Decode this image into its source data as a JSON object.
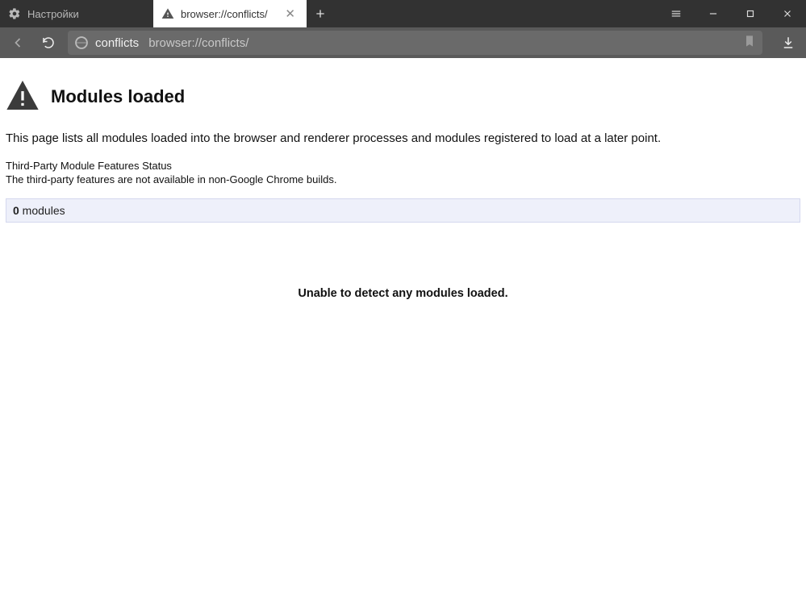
{
  "tabs": [
    {
      "title": "Настройки",
      "active": false
    },
    {
      "title": "browser://conflicts/",
      "active": true
    }
  ],
  "address": {
    "host": "conflicts",
    "url": "browser://conflicts/"
  },
  "page": {
    "title": "Modules loaded",
    "description": "This page lists all modules loaded into the browser and renderer processes and modules registered to load at a later point.",
    "status_heading": "Third-Party Module Features Status",
    "status_note": "The third-party features are not available in non-Google Chrome builds.",
    "module_count": "0",
    "module_count_label": " modules",
    "empty_message": "Unable to detect any modules loaded."
  }
}
